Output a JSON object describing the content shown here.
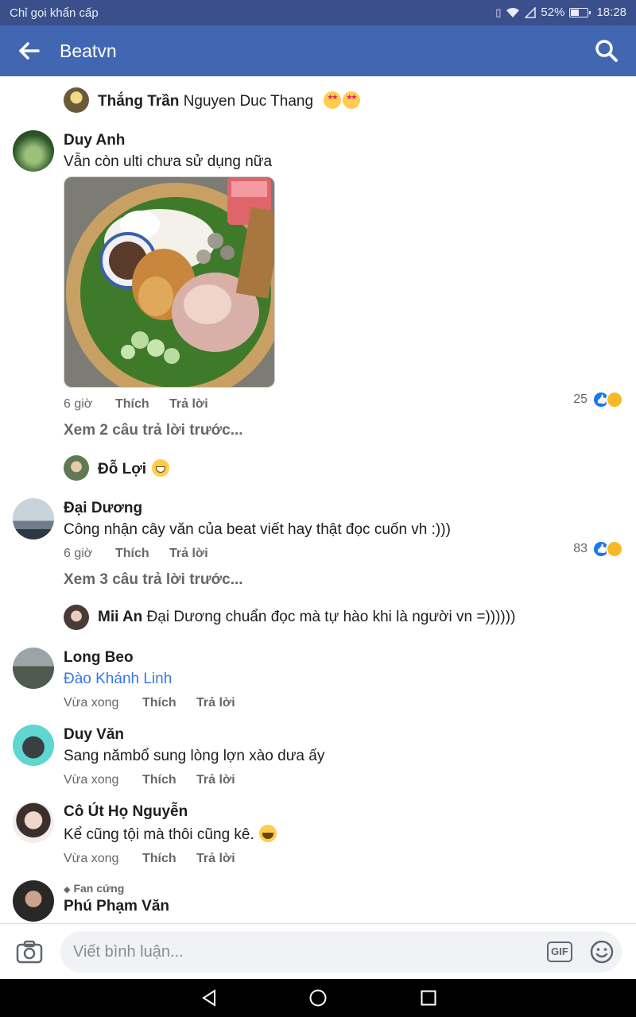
{
  "status_bar": {
    "carrier": "Chỉ gọi khẩn cấp",
    "battery": "52%",
    "battery_level": 0.52,
    "time": "18:28"
  },
  "app_bar": {
    "title": "Beatvn",
    "back_icon": "arrow-left-icon",
    "search_icon": "search-icon"
  },
  "comments": [
    {
      "reply": true,
      "author": "Thắng Trần",
      "text": "Nguyen Duc Thang"
    },
    {
      "author": "Duy Anh",
      "text": "Vẫn còn ulti chưa sử dụng nữa",
      "time": "6 giờ",
      "like": "Thích",
      "reply_label": "Trả lời",
      "reaction_count": "25",
      "more_replies": "Xem 2 câu trả lời trước..."
    },
    {
      "reply": true,
      "author": "Đỗ Lợi",
      "text": ""
    },
    {
      "author": "Đại Dương",
      "text": "Công nhận cây văn của beat viết hay thật đọc cuốn vh :)))",
      "time": "6 giờ",
      "like": "Thích",
      "reply_label": "Trả lời",
      "reaction_count": "83",
      "more_replies": "Xem 3 câu trả lời trước..."
    },
    {
      "reply": true,
      "author": "Mii An",
      "text": "Đại Dương chuẩn đọc mà tự hào khi là người vn =))))))"
    },
    {
      "author": "Long Beo",
      "text": "Đào Khánh Linh",
      "time": "Vừa xong",
      "like": "Thích",
      "reply_label": "Trả lời"
    },
    {
      "author": "Duy Văn",
      "text": "Sang nămbổ sung lòng lợn xào dưa ấy",
      "time": "Vừa xong",
      "like": "Thích",
      "reply_label": "Trả lời"
    },
    {
      "author": "Cô Út Họ Nguyễn",
      "text": "Kể cũng tội mà thôi cũng kê.",
      "time": "Vừa xong",
      "like": "Thích",
      "reply_label": "Trả lời"
    },
    {
      "badge": "Fan cứng",
      "author": "Phú Phạm Văn"
    }
  ],
  "composer": {
    "placeholder": "Viết bình luận...",
    "gif": "GIF"
  }
}
